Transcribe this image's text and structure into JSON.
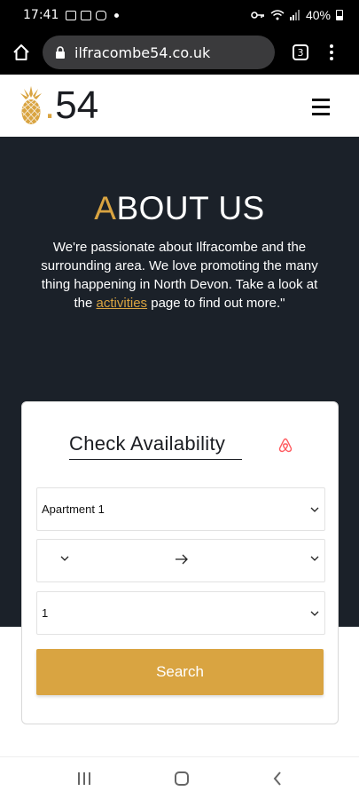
{
  "status_bar": {
    "time": "17:41",
    "battery": "40%"
  },
  "browser": {
    "url": "ilfracombe54.co.uk",
    "tab_count": "3"
  },
  "site": {
    "logo_dot": ".",
    "logo_number": "54"
  },
  "hero": {
    "title_first": "A",
    "title_rest": "BOUT US",
    "text_before": "We're passionate about Ilfracombe and the surrounding area. We love promoting the many thing happening in North Devon. Take a look at the ",
    "link": "activities",
    "text_after": " page to find out more.\""
  },
  "availability": {
    "title": "Check Availability",
    "apartment": "Apartment 1",
    "guests": "1",
    "search_label": "Search"
  },
  "colors": {
    "accent": "#d9a441",
    "hero_bg": "#1b2129",
    "airbnb": "#ff5a5f"
  }
}
